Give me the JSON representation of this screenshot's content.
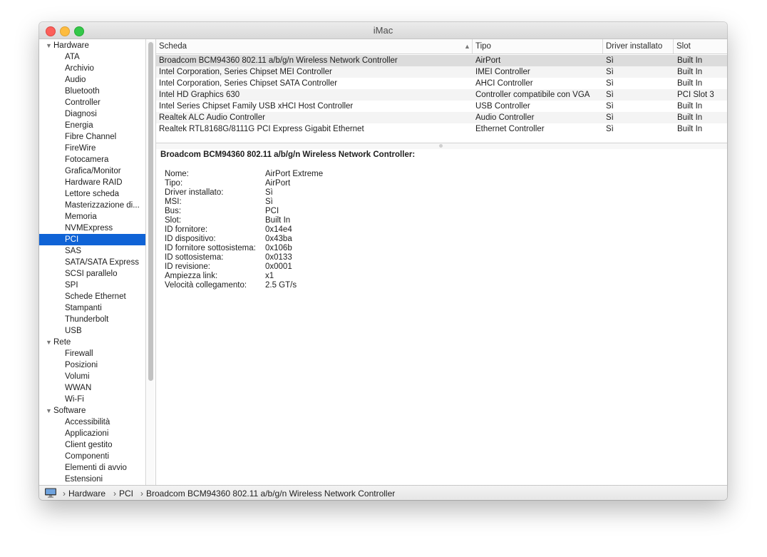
{
  "window": {
    "title": "iMac"
  },
  "sidebar": {
    "items": [
      {
        "label": "Hardware",
        "type": "category"
      },
      {
        "label": "ATA",
        "type": "child"
      },
      {
        "label": "Archivio",
        "type": "child"
      },
      {
        "label": "Audio",
        "type": "child"
      },
      {
        "label": "Bluetooth",
        "type": "child"
      },
      {
        "label": "Controller",
        "type": "child"
      },
      {
        "label": "Diagnosi",
        "type": "child"
      },
      {
        "label": "Energia",
        "type": "child"
      },
      {
        "label": "Fibre Channel",
        "type": "child"
      },
      {
        "label": "FireWire",
        "type": "child"
      },
      {
        "label": "Fotocamera",
        "type": "child"
      },
      {
        "label": "Grafica/Monitor",
        "type": "child"
      },
      {
        "label": "Hardware RAID",
        "type": "child"
      },
      {
        "label": "Lettore scheda",
        "type": "child"
      },
      {
        "label": "Masterizzazione di...",
        "type": "child"
      },
      {
        "label": "Memoria",
        "type": "child"
      },
      {
        "label": "NVMExpress",
        "type": "child"
      },
      {
        "label": "PCI",
        "type": "child",
        "selected": true
      },
      {
        "label": "SAS",
        "type": "child"
      },
      {
        "label": "SATA/SATA Express",
        "type": "child"
      },
      {
        "label": "SCSI parallelo",
        "type": "child"
      },
      {
        "label": "SPI",
        "type": "child"
      },
      {
        "label": "Schede Ethernet",
        "type": "child"
      },
      {
        "label": "Stampanti",
        "type": "child"
      },
      {
        "label": "Thunderbolt",
        "type": "child"
      },
      {
        "label": "USB",
        "type": "child"
      },
      {
        "label": "Rete",
        "type": "category"
      },
      {
        "label": "Firewall",
        "type": "child"
      },
      {
        "label": "Posizioni",
        "type": "child"
      },
      {
        "label": "Volumi",
        "type": "child"
      },
      {
        "label": "WWAN",
        "type": "child"
      },
      {
        "label": "Wi-Fi",
        "type": "child"
      },
      {
        "label": "Software",
        "type": "category"
      },
      {
        "label": "Accessibilità",
        "type": "child"
      },
      {
        "label": "Applicazioni",
        "type": "child"
      },
      {
        "label": "Client gestito",
        "type": "child"
      },
      {
        "label": "Componenti",
        "type": "child"
      },
      {
        "label": "Elementi di avvio",
        "type": "child"
      },
      {
        "label": "Estensioni",
        "type": "child"
      }
    ]
  },
  "table": {
    "columns": [
      "Scheda",
      "Tipo",
      "Driver installato",
      "Slot"
    ],
    "rows": [
      [
        "Broadcom BCM94360 802.11 a/b/g/n Wireless Network Controller",
        "AirPort",
        "Sì",
        "Built In"
      ],
      [
        "Intel Corporation, Series Chipset MEI Controller",
        "IMEI Controller",
        "Sì",
        "Built In"
      ],
      [
        "Intel Corporation, Series Chipset SATA Controller",
        "AHCI Controller",
        "Sì",
        "Built In"
      ],
      [
        "Intel HD Graphics 630",
        "Controller compatibile con VGA",
        "Sì",
        "PCI Slot 3"
      ],
      [
        "Intel Series Chipset Family USB xHCI Host Controller",
        "USB Controller",
        "Sì",
        "Built In"
      ],
      [
        "Realtek ALC Audio Controller",
        "Audio Controller",
        "Sì",
        "Built In"
      ],
      [
        "Realtek RTL8168G/8111G PCI Express Gigabit Ethernet",
        "Ethernet Controller",
        "Sì",
        "Built In"
      ]
    ],
    "selected_row": 0
  },
  "detail": {
    "title": "Broadcom BCM94360 802.11 a/b/g/n Wireless Network Controller:",
    "fields": [
      {
        "key": "Nome:",
        "value": "AirPort Extreme"
      },
      {
        "key": "Tipo:",
        "value": "AirPort"
      },
      {
        "key": "Driver installato:",
        "value": "Sì"
      },
      {
        "key": "MSI:",
        "value": "Sì"
      },
      {
        "key": "Bus:",
        "value": "PCI"
      },
      {
        "key": "Slot:",
        "value": "Built In"
      },
      {
        "key": "ID fornitore:",
        "value": "0x14e4"
      },
      {
        "key": "ID dispositivo:",
        "value": "0x43ba"
      },
      {
        "key": "ID fornitore sottosistema:",
        "value": "0x106b"
      },
      {
        "key": "ID sottosistema:",
        "value": "0x0133"
      },
      {
        "key": "ID revisione:",
        "value": "0x0001"
      },
      {
        "key": "Ampiezza link:",
        "value": "x1"
      },
      {
        "key": "Velocità collegamento:",
        "value": "2.5 GT/s"
      }
    ]
  },
  "statusbar": {
    "path": [
      "Hardware",
      "PCI",
      "Broadcom BCM94360 802.11 a/b/g/n Wireless Network Controller"
    ],
    "chevron": "›"
  },
  "colors": {
    "selection": "#0f63d6",
    "row_selected": "#dcdcdc",
    "row_alt": "#f4f4f4"
  }
}
